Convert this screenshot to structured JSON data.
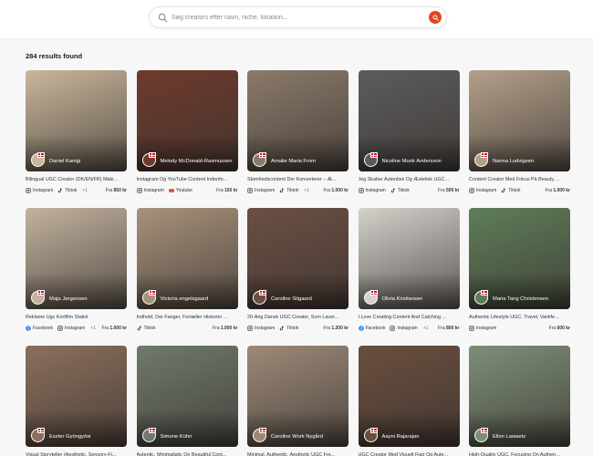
{
  "search": {
    "placeholder": "Søg creators efter navn, niche, lokation..."
  },
  "results_label": "284 results found",
  "price_prefix": "Fra",
  "colors": {
    "accent": "#e0451f",
    "flag_red": "#c8102e"
  },
  "cards": [
    {
      "name": "Daniel Kanigi",
      "desc": "Bilingual UGC Creator (DK/EN/FR) Maki...",
      "platforms": [
        "Instagram",
        "Tiktok"
      ],
      "more": "+1",
      "price": "850 kr",
      "tone": "#c9b79b"
    },
    {
      "name": "Melody McDonald-Rasmussen",
      "desc": "Instagram Og YouTube Content Indenfo...",
      "platforms": [
        "Instagram",
        "Youtube"
      ],
      "more": "",
      "price": "150 kr",
      "tone": "#6e3a2c"
    },
    {
      "name": "Amalie Maria From",
      "desc": "Skønhedscontent Der Konverterer – Æ...",
      "platforms": [
        "Instagram",
        "Tiktok"
      ],
      "more": "+1",
      "price": "1.000 kr",
      "tone": "#8a7a6a"
    },
    {
      "name": "Nicoline Munk Andersson",
      "desc": "Jeg Skaber Autentisk Og Æstetisk UGC...",
      "platforms": [
        "Instagram",
        "Tiktok"
      ],
      "more": "",
      "price": "500 kr",
      "tone": "#5c5c5c"
    },
    {
      "name": "Nanna Ludvigsen",
      "desc": "Content Creator Med Fokus På Beauty, ...",
      "platforms": [
        "Instagram",
        "Tiktok"
      ],
      "more": "",
      "price": "1.000 kr",
      "tone": "#b3a08a"
    },
    {
      "name": "Maja Jørgensen",
      "desc": "Reklame Ugc Kortfilm Statist",
      "platforms": [
        "Facebook",
        "Instagram"
      ],
      "more": "+1",
      "price": "1.000 kr",
      "tone": "#c2b29e"
    },
    {
      "name": "Victoria engelsgaard",
      "desc": "Indhold, Der Fanger, Fortæller Historier ...",
      "platforms": [
        "Tiktok"
      ],
      "more": "",
      "price": "1.000 kr",
      "tone": "#a7927b"
    },
    {
      "name": "Caroline Stigaard",
      "desc": "20-Årig Dansk UGC Creator, Som Laver...",
      "platforms": [
        "Instagram",
        "Tiktok"
      ],
      "more": "",
      "price": "1.200 kr",
      "tone": "#6b4f43"
    },
    {
      "name": "Olivia Kristiansen",
      "desc": "I Love Creating Content And Catching ...",
      "platforms": [
        "Facebook",
        "Instagram"
      ],
      "more": "+1",
      "price": "800 kr",
      "tone": "#d4d1cb"
    },
    {
      "name": "Maria Tang Christensen",
      "desc": "Authentic Lifestyle UGC, Travel, Vanlife...",
      "platforms": [
        "Instagram"
      ],
      "more": "",
      "price": "600 kr",
      "tone": "#5f7d59"
    },
    {
      "name": "Eszter Gyöngyösi",
      "desc": "Visual Storyteller (Aesthetic, Sensory-Fi...",
      "platforms": [],
      "more": "",
      "price": "",
      "tone": "#8b6f5c"
    },
    {
      "name": "Simone Kühn",
      "desc": "Autentic, Minimalistic On Beautiful Cont...",
      "platforms": [],
      "more": "",
      "price": "",
      "tone": "#6f7a6c"
    },
    {
      "name": "Caroline Work Nygård",
      "desc": "Minimal, Authentic, Aesthetic UGC For...",
      "platforms": [],
      "more": "",
      "price": "",
      "tone": "#9c8a78"
    },
    {
      "name": "Aayni Rajarajan",
      "desc": "UGC Creator Med Visuelt Flair Og Aute...",
      "platforms": [],
      "more": "",
      "price": "",
      "tone": "#6a4e3e"
    },
    {
      "name": "Ellen Lawaetz",
      "desc": "High-Quality UGC, Focusing On Authen...",
      "platforms": [],
      "more": "",
      "price": "",
      "tone": "#7d8f77"
    }
  ]
}
